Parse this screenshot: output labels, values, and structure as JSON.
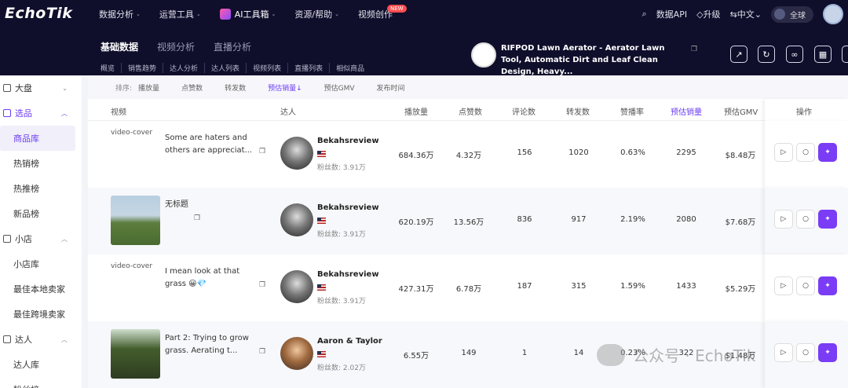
{
  "brand": {
    "logo": "EchoTik"
  },
  "nav": {
    "items": [
      {
        "label": "数据分析"
      },
      {
        "label": "运营工具"
      },
      {
        "label": "AI工具箱"
      },
      {
        "label": "资源/帮助"
      },
      {
        "label": "视频创作"
      }
    ],
    "new_badge": "NEW",
    "right": {
      "api": "数据API",
      "upgrade": "升级",
      "lang": "中文",
      "region": "全球"
    }
  },
  "tabs": [
    {
      "label": "基础数据"
    },
    {
      "label": "视频分析"
    },
    {
      "label": "直播分析"
    }
  ],
  "subtabs": [
    {
      "label": "概览"
    },
    {
      "label": "销售趋势"
    },
    {
      "label": "达人分析"
    },
    {
      "label": "达人列表"
    },
    {
      "label": "视频列表"
    },
    {
      "label": "直播列表"
    },
    {
      "label": "相似商品"
    }
  ],
  "product": {
    "title": "RIFPOD Lawn Aerator - Aerator Lawn Tool, Automatic Dirt and Leaf Clean Design, Heavy..."
  },
  "sidebar": {
    "groups": [
      {
        "label": "大盘",
        "items": []
      },
      {
        "label": "选品",
        "items": [
          {
            "label": "商品库"
          },
          {
            "label": "热销榜"
          },
          {
            "label": "热推榜"
          },
          {
            "label": "新品榜"
          }
        ]
      },
      {
        "label": "小店",
        "items": [
          {
            "label": "小店库"
          },
          {
            "label": "最佳本地卖家"
          },
          {
            "label": "最佳跨境卖家"
          }
        ]
      },
      {
        "label": "达人",
        "items": [
          {
            "label": "达人库"
          },
          {
            "label": "粉丝榜"
          }
        ]
      }
    ]
  },
  "sortbar": {
    "label": "排序:",
    "items": [
      {
        "label": "播放量"
      },
      {
        "label": "点赞数"
      },
      {
        "label": "转发数"
      },
      {
        "label": "预估销量↓"
      },
      {
        "label": "预估GMV"
      },
      {
        "label": "发布时间"
      }
    ]
  },
  "table": {
    "headers": {
      "video": "视频",
      "creator": "达人",
      "plays": "播放量",
      "likes": "点赞数",
      "comments": "评论数",
      "shares": "转发数",
      "like_rate": "赞播率",
      "est_sales": "预估销量",
      "est_gmv": "预估GMV",
      "ops": "操作"
    },
    "rows": [
      {
        "cover_alt": "video-cover",
        "title": "Some are haters and others are appreciat...",
        "creator": "Bekahsreview",
        "fans": "粉丝数: 3.91万",
        "plays": "684.36万",
        "likes": "4.32万",
        "comments": "156",
        "shares": "1020",
        "like_rate": "0.63%",
        "est_sales": "2295",
        "est_gmv": "$8.48万"
      },
      {
        "cover_alt": "",
        "title": "无标题",
        "creator": "Bekahsreview",
        "fans": "粉丝数: 3.91万",
        "plays": "620.19万",
        "likes": "13.56万",
        "comments": "836",
        "shares": "917",
        "like_rate": "2.19%",
        "est_sales": "2080",
        "est_gmv": "$7.68万"
      },
      {
        "cover_alt": "video-cover",
        "title": "I mean look at that grass 😀💎",
        "creator": "Bekahsreview",
        "fans": "粉丝数: 3.91万",
        "plays": "427.31万",
        "likes": "6.78万",
        "comments": "187",
        "shares": "315",
        "like_rate": "1.59%",
        "est_sales": "1433",
        "est_gmv": "$5.29万"
      },
      {
        "cover_alt": "",
        "title": "Part 2: Trying to grow grass. Aerating t...",
        "creator": "Aaron & Taylor",
        "fans": "粉丝数: 2.02万",
        "plays": "6.55万",
        "likes": "149",
        "comments": "1",
        "shares": "14",
        "like_rate": "0.23%",
        "est_sales": "322",
        "est_gmv": "$1.48万"
      }
    ]
  },
  "watermark": "公众号 · EchoTik",
  "icons": [
    "search-icon",
    "diamond-icon",
    "globe-icon",
    "share-icon",
    "refresh-icon",
    "link-icon",
    "grid-icon",
    "copy-icon",
    "play-icon",
    "search-small-icon",
    "ai-sparkle-icon"
  ]
}
